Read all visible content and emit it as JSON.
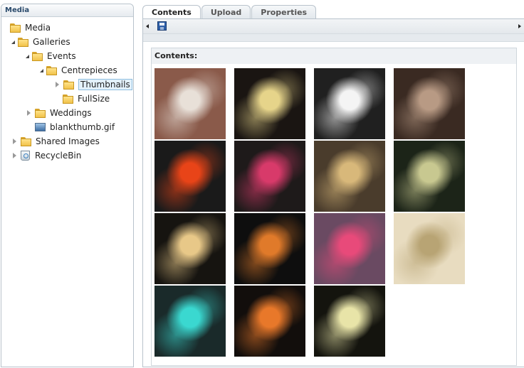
{
  "tree": {
    "header": "Media",
    "nodes": [
      {
        "label": "Media",
        "type": "folder",
        "toggle": "open"
      },
      {
        "label": "Galleries",
        "type": "folder",
        "toggle": "open"
      },
      {
        "label": "Events",
        "type": "folder",
        "toggle": "open"
      },
      {
        "label": "Centrepieces",
        "type": "folder",
        "toggle": "open"
      },
      {
        "label": "Thumbnails",
        "type": "folder",
        "toggle": "closed",
        "selected": true
      },
      {
        "label": "FullSize",
        "type": "folder",
        "toggle": "none"
      },
      {
        "label": "Weddings",
        "type": "folder",
        "toggle": "closed"
      },
      {
        "label": "blankthumb.gif",
        "type": "file",
        "toggle": "none"
      },
      {
        "label": "Shared Images",
        "type": "folder",
        "toggle": "closed"
      },
      {
        "label": "RecycleBin",
        "type": "recycle",
        "toggle": "closed"
      }
    ]
  },
  "tabs": [
    {
      "label": "Contents",
      "active": true
    },
    {
      "label": "Upload",
      "active": false
    },
    {
      "label": "Properties",
      "active": false
    }
  ],
  "contents": {
    "title": "Contents:",
    "thumbnails": [
      {
        "icon": "cake-centrepiece-photo",
        "bg": "#8a5a4a",
        "accent": "#e8e0d8"
      },
      {
        "icon": "flower-vase-photo",
        "bg": "#1a1512",
        "accent": "#e6d48a"
      },
      {
        "icon": "film-reel-photo",
        "bg": "#202020",
        "accent": "#f4f4f4"
      },
      {
        "icon": "vintage-men-photo",
        "bg": "#3a2a22",
        "accent": "#b89a84"
      },
      {
        "icon": "red-gerbera-photo",
        "bg": "#1a1a1a",
        "accent": "#e84418"
      },
      {
        "icon": "tall-vase-photo",
        "bg": "#1e1a1a",
        "accent": "#d83a6a"
      },
      {
        "icon": "birdcage-photo",
        "bg": "#4a3c2c",
        "accent": "#d8b87a"
      },
      {
        "icon": "white-flowers-photo",
        "bg": "#1c2418",
        "accent": "#c8c890"
      },
      {
        "icon": "martini-glass-photo",
        "bg": "#161410",
        "accent": "#e8c888"
      },
      {
        "icon": "heliconia-photo",
        "bg": "#0e0e0e",
        "accent": "#e07a2a"
      },
      {
        "icon": "pink-roses-photo",
        "bg": "#6a4a62",
        "accent": "#e84a7a"
      },
      {
        "icon": "cream-centrepiece-photo",
        "bg": "#e8dcc0",
        "accent": "#b8a474"
      },
      {
        "icon": "mirror-ball-photo",
        "bg": "#1a2a2a",
        "accent": "#3ad8d0"
      },
      {
        "icon": "bird-of-paradise-photo",
        "bg": "#120e0c",
        "accent": "#e8782a"
      },
      {
        "icon": "ivory-roses-photo",
        "bg": "#14140e",
        "accent": "#e8e4a8"
      }
    ]
  },
  "colors": {
    "accent": "#2a4a6b",
    "border": "#b9c3cc",
    "selection": "#e3f1fb"
  }
}
